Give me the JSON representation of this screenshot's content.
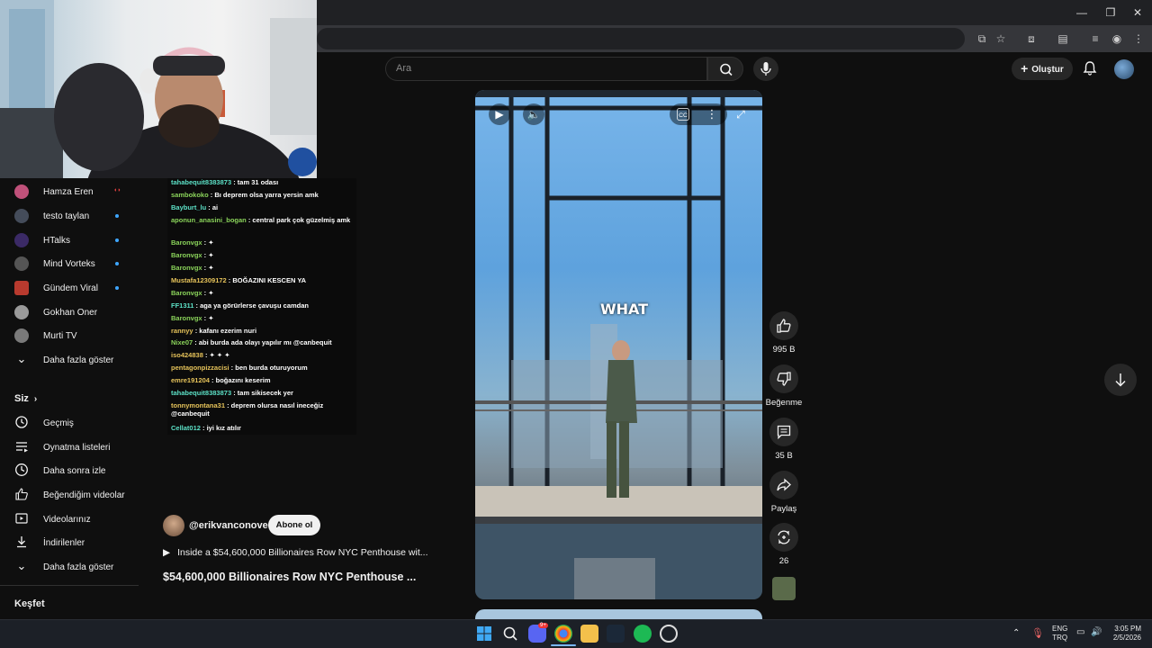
{
  "search": {
    "placeholder": "Ara"
  },
  "header": {
    "create_label": "Oluştur"
  },
  "sidebar": {
    "subscriptions": [
      {
        "name": "Hamza Eren",
        "color": "#c0517a",
        "live": "red"
      },
      {
        "name": "testo taylan",
        "color": "#444c5a",
        "live": "blue"
      },
      {
        "name": "HTalks",
        "color": "#3b2a66",
        "live": "blue"
      },
      {
        "name": "Mind Vorteks",
        "color": "#555555",
        "live": "blue"
      },
      {
        "name": "Gündem Viral",
        "color": "#b83a2e",
        "live": "blue"
      },
      {
        "name": "Gokhan Oner",
        "color": "#9a9a9a",
        "live": ""
      },
      {
        "name": "Murti TV",
        "color": "#7a7a7a",
        "live": ""
      }
    ],
    "show_more": "Daha fazla göster",
    "you_header": "Siz",
    "you_items": [
      {
        "label": "Geçmiş",
        "icon": "history-icon"
      },
      {
        "label": "Oynatma listeleri",
        "icon": "playlists-icon"
      },
      {
        "label": "Daha sonra izle",
        "icon": "watch-later-icon"
      },
      {
        "label": "Beğendiğim videolar",
        "icon": "liked-icon"
      },
      {
        "label": "Videolarınız",
        "icon": "your-videos-icon"
      },
      {
        "label": "İndirilenler",
        "icon": "downloads-icon"
      }
    ],
    "show_more_2": "Daha fazla göster",
    "explore_header": "Keşfet"
  },
  "chat": [
    {
      "user": "tahabequit8383873",
      "color": "#5ce0c6",
      "text": " : tam 31 odası"
    },
    {
      "user": "sambokoko",
      "color": "#8ad35a",
      "text": " : Bı deprem olsa yarra yersin amk"
    },
    {
      "user": "Bayburt_lu",
      "color": "#5ce0c6",
      "text": " : ai"
    },
    {
      "user": "aponun_anasini_bogan",
      "color": "#8ad35a",
      "text": " : central park çok güzelmiş amk"
    },
    {
      "user": "Baronvgx",
      "color": "#8ad35a",
      "text": " :  ✦"
    },
    {
      "user": "Baronvgx",
      "color": "#8ad35a",
      "text": " :  ✦"
    },
    {
      "user": "Baronvgx",
      "color": "#8ad35a",
      "text": " :  ✦"
    },
    {
      "user": "Mustafa12309172",
      "color": "#e6c35a",
      "text": " : BOĞAZINI KESCEN YA"
    },
    {
      "user": "Baronvgx",
      "color": "#8ad35a",
      "text": " :  ✦"
    },
    {
      "user": "FF1311",
      "color": "#5ce0c6",
      "text": " : aga ya görürlerse çavuşu camdan"
    },
    {
      "user": "Baronvgx",
      "color": "#8ad35a",
      "text": " :  ✦"
    },
    {
      "user": "rannyy",
      "color": "#e6c35a",
      "text": " : kafanı ezerim nuri"
    },
    {
      "user": "Nixe07",
      "color": "#8ad35a",
      "text": " : abi burda ada olayı yapılır mı @canbequit"
    },
    {
      "user": "iso424838",
      "color": "#e6c35a",
      "text": " :  ✦  ✦  ✦"
    },
    {
      "user": "pentagonpizzacisi",
      "color": "#e6c35a",
      "text": " : ben burda oturuyorum"
    },
    {
      "user": "emre191204",
      "color": "#e6c35a",
      "text": " : boğazını keserim"
    },
    {
      "user": "tahabequit8383873",
      "color": "#5ce0c6",
      "text": " : tam sikisecek yer"
    },
    {
      "user": "tonnymontana31",
      "color": "#e6c35a",
      "text": " : deprem olursa nasıl ineceğiz @canbequit"
    },
    {
      "user": "Cellat012",
      "color": "#5ce0c6",
      "text": " : iyi kız atılır"
    }
  ],
  "video": {
    "caption": "WHAT",
    "likes": "995 B",
    "dislike_label": "Beğenme",
    "comments": "35 B",
    "share_label": "Paylaş",
    "remix": "26"
  },
  "channel": {
    "handle": "@erikvanconover",
    "subscribe_label": "Abone ol",
    "playlist_line": "Inside a $54,600,000 Billionaires Row NYC Penthouse wit...",
    "title": "$54,600,000 Billionaires Row NYC Penthouse ..."
  },
  "taskbar": {
    "lang_top": "ENG",
    "lang_bottom": "TRQ",
    "time": "3:05 PM",
    "date": "2/5/2026",
    "discord_badge": "9+"
  }
}
